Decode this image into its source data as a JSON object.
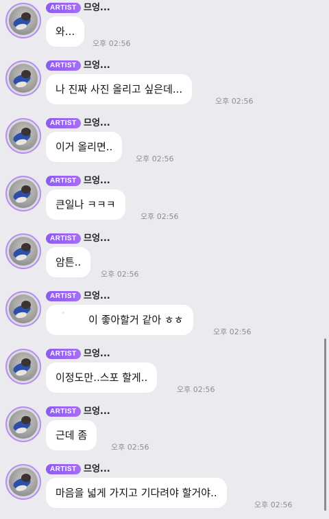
{
  "chat": {
    "messages": [
      {
        "badge": "ARTIST",
        "sender": "므엉...",
        "text": "와...",
        "time": "오후 02:56"
      },
      {
        "badge": "ARTIST",
        "sender": "므엉...",
        "text": "나 진짜 사진 올리고 싶은데...",
        "time": "오후 02:56"
      },
      {
        "badge": "ARTIST",
        "sender": "므엉...",
        "text": "이거 올리면..",
        "time": "오후 02:56"
      },
      {
        "badge": "ARTIST",
        "sender": "므엉...",
        "text": "큰일나 ㅋㅋㅋ",
        "time": "오후 02:56"
      },
      {
        "badge": "ARTIST",
        "sender": "므엉...",
        "text": "암튼..",
        "time": "오후 02:56"
      },
      {
        "badge": "ARTIST",
        "sender": "므엉...",
        "text": "이 좋아할거 같아 ㅎㅎ",
        "time": "오후 02:56"
      },
      {
        "badge": "ARTIST",
        "sender": "므엉...",
        "text": "이정도만..스포 할게..",
        "time": "오후 02:56"
      },
      {
        "badge": "ARTIST",
        "sender": "므엉...",
        "text": "근데 좀",
        "time": "오후 02:56"
      },
      {
        "badge": "ARTIST",
        "sender": "므엉...",
        "text": "마음을 넓게 가지고 기다려야 할거야..",
        "time": "오후 02:56"
      }
    ]
  },
  "icons": {
    "avatar": "artist-avatar-photo"
  },
  "colors": {
    "background": "#eaeaef",
    "bubble": "#ffffff",
    "badge": "#9b65f2",
    "avatar_ring": "#b78bf0",
    "time": "#8d8d92"
  }
}
